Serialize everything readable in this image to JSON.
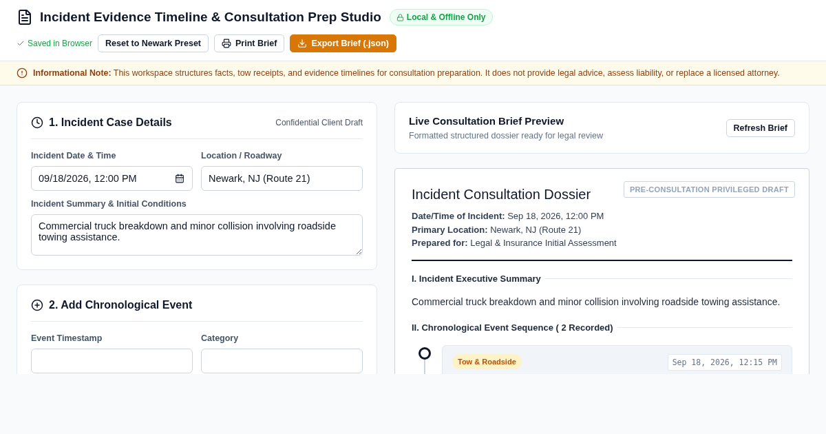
{
  "header": {
    "title": "Incident Evidence Timeline & Consultation Prep Studio",
    "badge": "Local & Offline Only",
    "saved": "Saved in Browser",
    "buttons": [
      {
        "kind": "plain",
        "label": "Reset to Newark Preset"
      },
      {
        "kind": "print",
        "label": "Print Brief"
      },
      {
        "kind": "export",
        "label": "Export Brief (.json)"
      }
    ]
  },
  "notice": {
    "label": "Informational Note:",
    "text": "This workspace structures facts, tow receipts, and evidence timelines for consultation preparation. It does not provide legal advice, assess liability, or replace a licensed attorney."
  },
  "case_card": {
    "title": "1. Incident Case Details",
    "tag": "Confidential Client Draft",
    "date_label": "Incident Date & Time",
    "date_value": "09/18/2026, 12:00 PM",
    "location_label": "Location / Roadway",
    "location_value": "Newark, NJ (Route 21)",
    "summary_label": "Incident Summary & Initial Conditions",
    "summary_value": "Commercial truck breakdown and minor collision involving roadside towing assistance."
  },
  "event_card": {
    "title": "2. Add Chronological Event",
    "timestamp_label": "Event Timestamp",
    "category_label": "Category"
  },
  "preview": {
    "title": "Live Consultation Brief Preview",
    "subtitle": "Formatted structured dossier ready for legal review",
    "button": "Refresh Brief"
  },
  "dossier": {
    "stamp": "PRE-CONSULTATION PRIVILEGED DRAFT",
    "title": "Incident Consultation Dossier",
    "meta": [
      {
        "label": "Date/Time of Incident:",
        "value": "Sep 18, 2026, 12:00 PM"
      },
      {
        "label": "Primary Location:",
        "value": "Newark, NJ (Route 21)"
      },
      {
        "label": "Prepared for:",
        "value": "Legal & Insurance Initial Assessment"
      }
    ],
    "summary_heading": "I. Incident Executive Summary",
    "summary": "Commercial truck breakdown and minor collision involving roadside towing assistance.",
    "sequence_heading_start": "II. Chronological Event Sequence (",
    "sequence_count": "2",
    "sequence_heading_end": "Recorded)",
    "events": [
      {
        "category": "Tow & Roadside",
        "color": "#fef3c7",
        "timestamp": "Sep 18, 2026, 12:15 PM"
      }
    ]
  }
}
